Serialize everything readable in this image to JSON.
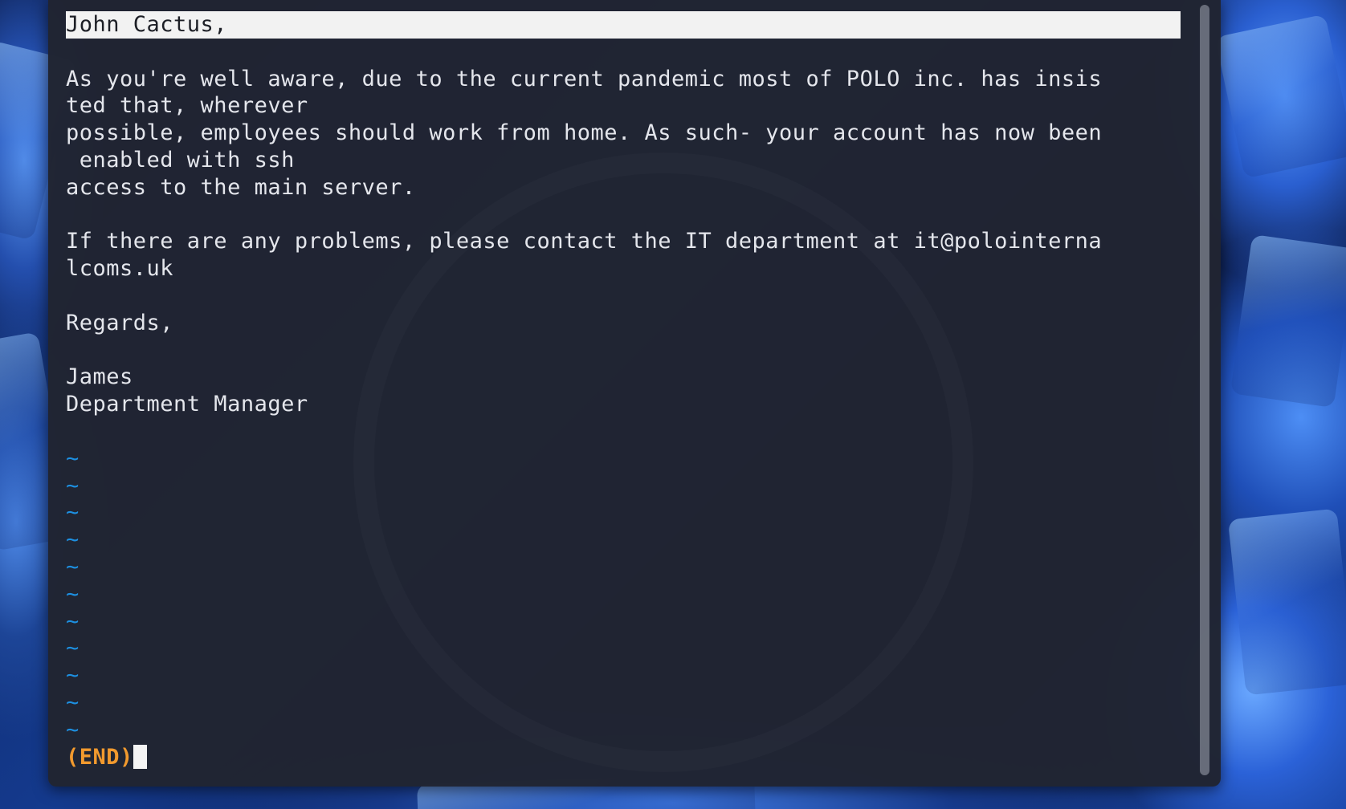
{
  "pager": {
    "lines": [
      "John Cactus,",
      "",
      "As you're well aware, due to the current pandemic most of POLO inc. has insis",
      "ted that, wherever",
      "possible, employees should work from home. As such- your account has now been",
      " enabled with ssh",
      "access to the main server.",
      "",
      "If there are any problems, please contact the IT department at it@polointerna",
      "lcoms.uk",
      "",
      "Regards,",
      "",
      "James",
      "Department Manager",
      ""
    ],
    "filler_tilde": "~",
    "filler_count": 11,
    "end_marker": "(END)"
  },
  "colors": {
    "tilde": "#1d8fe0",
    "end_marker": "#f29a2e",
    "highlight_bg": "#f2f2f2",
    "terminal_bg": "#212532"
  }
}
